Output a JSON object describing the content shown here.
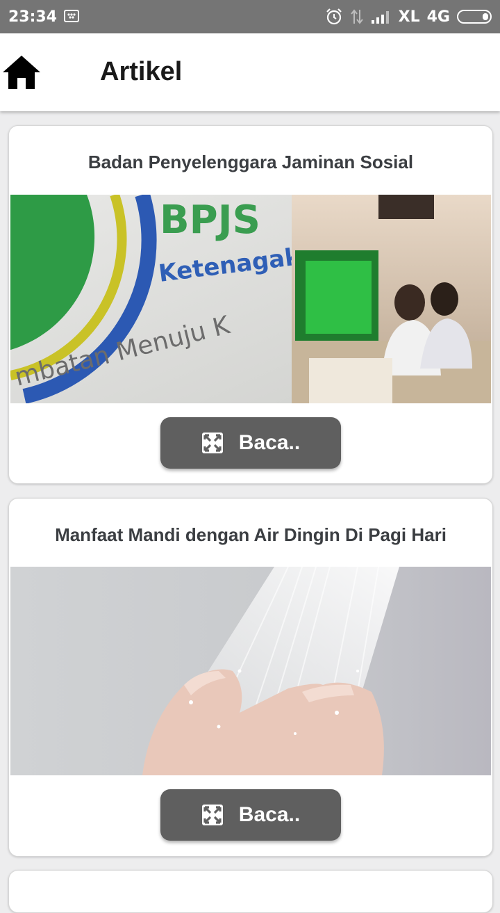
{
  "status_bar": {
    "time": "23:34",
    "carrier": "XL",
    "network": "4G",
    "icons": [
      "bbm-notification-icon",
      "alarm-icon",
      "data-arrows-icon",
      "signal-icon",
      "battery-icon"
    ]
  },
  "app_bar": {
    "title": "Artikel",
    "home_icon": "home-icon"
  },
  "articles": [
    {
      "title": "Badan Penyelenggara Jaminan Sosial",
      "image_text": {
        "brand": "BPJS",
        "brand_sub": "Ketenagakerjaan",
        "tagline": "mbatan Menuju K"
      },
      "button_label": "Baca..",
      "button_icon": "expand-icon"
    },
    {
      "title": "Manfaat Mandi dengan Air Dingin Di Pagi Hari",
      "button_label": "Baca..",
      "button_icon": "expand-icon"
    }
  ],
  "colors": {
    "status_bar": "#757575",
    "button": "#5f5f5f",
    "card_title": "#3b3e42",
    "background": "#ededee"
  }
}
